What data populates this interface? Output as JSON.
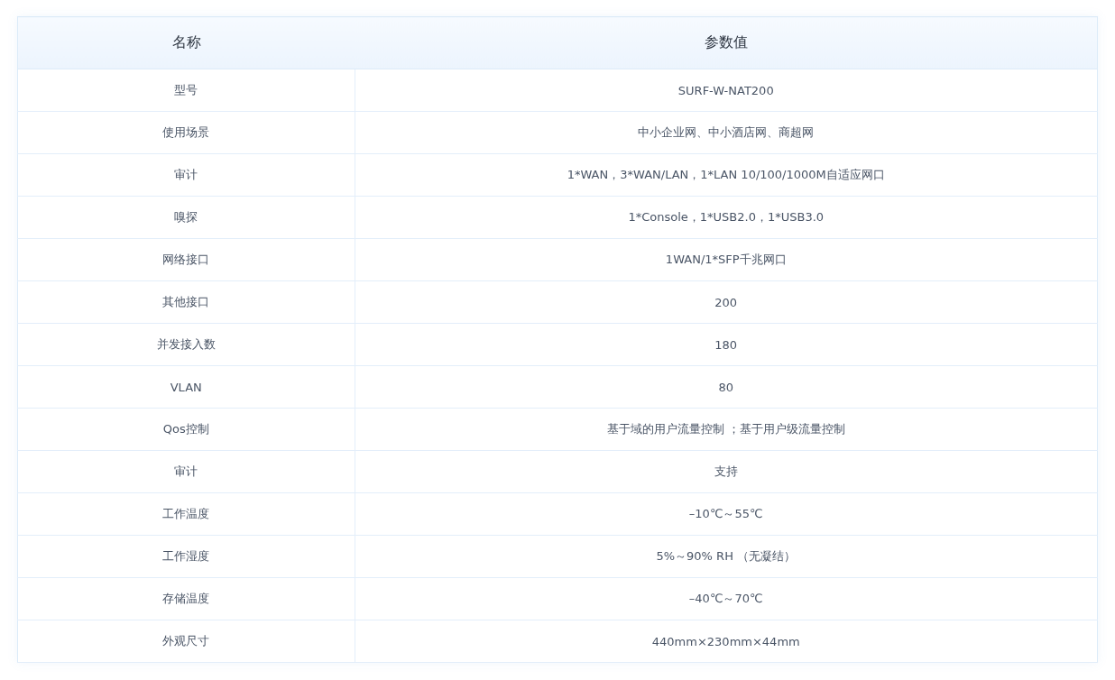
{
  "table": {
    "columns": [
      "名称",
      "参数值"
    ],
    "rows": [
      [
        "型号",
        "SURF-W-NAT200"
      ],
      [
        "使用场景",
        "中小企业网、中小酒店网、商超网"
      ],
      [
        "审计",
        "1*WAN，3*WAN/LAN，1*LAN 10/100/1000M自适应网口"
      ],
      [
        "嗅探",
        "1*Console，1*USB2.0，1*USB3.0"
      ],
      [
        "网络接口",
        "1WAN/1*SFP千兆网口"
      ],
      [
        "其他接口",
        "200"
      ],
      [
        "并发接入数",
        "180"
      ],
      [
        "VLAN",
        "80"
      ],
      [
        "Qos控制",
        "基于域的用户流量控制 ；基于用户级流量控制"
      ],
      [
        "审计",
        "支持"
      ],
      [
        "工作温度",
        "–10℃～55℃"
      ],
      [
        "工作湿度",
        "5%～90% RH （无凝结）"
      ],
      [
        "存储温度",
        "–40℃～70℃"
      ],
      [
        "外观尺寸",
        "440mm×230mm×44mm"
      ]
    ]
  }
}
